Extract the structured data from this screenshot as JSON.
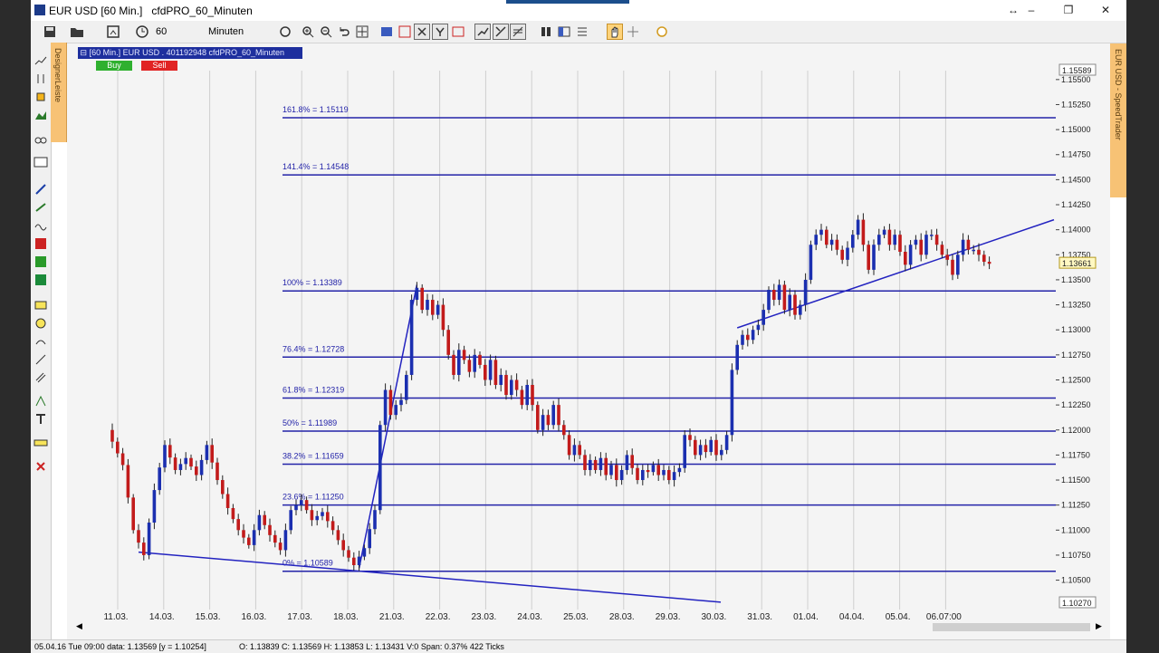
{
  "window": {
    "title": "EUR USD [60 Min.]",
    "subtitle": "cfdPRO_60_Minuten",
    "controls": [
      "↔",
      "–",
      "❐",
      "✕"
    ]
  },
  "toolbar": {
    "period_value": "60",
    "period_unit": "Minuten"
  },
  "designer_label": "DesignerLeiste",
  "speedtrader_label": "EUR USD - SpeedTrader",
  "chart_header": {
    "instrument": "[60 Min.] EUR USD . 401192948 cfdPRO_60_Minuten",
    "buy_label": "Buy",
    "sell_label": "Sell"
  },
  "chart_data": {
    "type": "candlestick",
    "instrument": "EUR USD",
    "x_tick_labels": [
      "11.03.",
      "14.03.",
      "15.03.",
      "16.03.",
      "17.03.",
      "18.03.",
      "21.03.",
      "22.03.",
      "23.03.",
      "24.03.",
      "25.03.",
      "28.03.",
      "29.03.",
      "30.03.",
      "31.03.",
      "01.04.",
      "04.04.",
      "05.04.",
      "06.07:00"
    ],
    "y_tick_labels": [
      "1.15500",
      "1.15250",
      "1.15000",
      "1.14750",
      "1.14500",
      "1.14250",
      "1.14000",
      "1.13750",
      "1.13500",
      "1.13250",
      "1.13000",
      "1.12750",
      "1.12500",
      "1.12250",
      "1.12000",
      "1.11750",
      "1.11500",
      "1.11250",
      "1.11000",
      "1.10750",
      "1.10500"
    ],
    "ylim": [
      1.1027,
      1.15589
    ],
    "axis_top_label": "1.15589",
    "axis_bottom_label": "1.10270",
    "current_price_label": "1.13661",
    "current_price": 1.13661,
    "fibonacci_levels": [
      {
        "label": "161.8% = 1.15119",
        "price": 1.15119
      },
      {
        "label": "141.4% = 1.14548",
        "price": 1.14548
      },
      {
        "label": "100% = 1.13389",
        "price": 1.13389
      },
      {
        "label": "76.4% = 1.12728",
        "price": 1.12728
      },
      {
        "label": "61.8% = 1.12319",
        "price": 1.12319
      },
      {
        "label": "50% = 1.11989",
        "price": 1.11989
      },
      {
        "label": "38.2% = 1.11659",
        "price": 1.11659
      },
      {
        "label": "23.6% = 1.11250",
        "price": 1.1125
      },
      {
        "label": "0% = 1.10589",
        "price": 1.10589
      }
    ],
    "price_path": [
      [
        0,
        1.12
      ],
      [
        3,
        1.1165
      ],
      [
        5,
        1.11
      ],
      [
        7,
        1.1075
      ],
      [
        9,
        1.114
      ],
      [
        11,
        1.1185
      ],
      [
        13,
        1.116
      ],
      [
        15,
        1.1172
      ],
      [
        17,
        1.1155
      ],
      [
        19,
        1.1185
      ],
      [
        21,
        1.115
      ],
      [
        23,
        1.1122
      ],
      [
        25,
        1.11
      ],
      [
        27,
        1.1085
      ],
      [
        29,
        1.1115
      ],
      [
        31,
        1.1095
      ],
      [
        33,
        1.108
      ],
      [
        35,
        1.112
      ],
      [
        37,
        1.113
      ],
      [
        39,
        1.111
      ],
      [
        41,
        1.1118
      ],
      [
        43,
        1.11
      ],
      [
        45,
        1.108
      ],
      [
        47,
        1.1065
      ],
      [
        49,
        1.1082
      ],
      [
        51,
        1.112
      ],
      [
        52,
        1.1205
      ],
      [
        53,
        1.124
      ],
      [
        54,
        1.1215
      ],
      [
        55,
        1.1225
      ],
      [
        56,
        1.123
      ],
      [
        57,
        1.1255
      ],
      [
        58,
        1.133
      ],
      [
        59,
        1.1342
      ],
      [
        60,
        1.132
      ],
      [
        61,
        1.133
      ],
      [
        62,
        1.1315
      ],
      [
        63,
        1.1325
      ],
      [
        64,
        1.13
      ],
      [
        65,
        1.1275
      ],
      [
        66,
        1.1255
      ],
      [
        67,
        1.128
      ],
      [
        68,
        1.127
      ],
      [
        69,
        1.1258
      ],
      [
        70,
        1.1275
      ],
      [
        71,
        1.1265
      ],
      [
        72,
        1.125
      ],
      [
        73,
        1.127
      ],
      [
        74,
        1.1245
      ],
      [
        75,
        1.1255
      ],
      [
        76,
        1.1235
      ],
      [
        77,
        1.125
      ],
      [
        78,
        1.124
      ],
      [
        79,
        1.1225
      ],
      [
        80,
        1.1245
      ],
      [
        81,
        1.1225
      ],
      [
        82,
        1.12
      ],
      [
        83,
        1.1215
      ],
      [
        84,
        1.1205
      ],
      [
        85,
        1.1225
      ],
      [
        86,
        1.1205
      ],
      [
        87,
        1.1195
      ],
      [
        88,
        1.1175
      ],
      [
        89,
        1.1185
      ],
      [
        90,
        1.1175
      ],
      [
        91,
        1.116
      ],
      [
        92,
        1.117
      ],
      [
        93,
        1.116
      ],
      [
        94,
        1.1172
      ],
      [
        95,
        1.1155
      ],
      [
        96,
        1.1165
      ],
      [
        97,
        1.115
      ],
      [
        98,
        1.116
      ],
      [
        99,
        1.1175
      ],
      [
        100,
        1.1162
      ],
      [
        101,
        1.115
      ],
      [
        102,
        1.116
      ],
      [
        103,
        1.1158
      ],
      [
        104,
        1.1165
      ],
      [
        105,
        1.1155
      ],
      [
        106,
        1.116
      ],
      [
        107,
        1.115
      ],
      [
        108,
        1.1158
      ],
      [
        109,
        1.1162
      ],
      [
        110,
        1.1195
      ],
      [
        111,
        1.119
      ],
      [
        112,
        1.1175
      ],
      [
        113,
        1.1185
      ],
      [
        114,
        1.1178
      ],
      [
        115,
        1.119
      ],
      [
        116,
        1.1175
      ],
      [
        117,
        1.118
      ],
      [
        118,
        1.1195
      ],
      [
        119,
        1.126
      ],
      [
        120,
        1.1285
      ],
      [
        121,
        1.1295
      ],
      [
        122,
        1.129
      ],
      [
        123,
        1.13
      ],
      [
        124,
        1.1305
      ],
      [
        125,
        1.132
      ],
      [
        126,
        1.134
      ],
      [
        127,
        1.133
      ],
      [
        128,
        1.1345
      ],
      [
        129,
        1.132
      ],
      [
        130,
        1.1335
      ],
      [
        131,
        1.1315
      ],
      [
        132,
        1.1325
      ],
      [
        133,
        1.135
      ],
      [
        134,
        1.1385
      ],
      [
        135,
        1.1395
      ],
      [
        136,
        1.14
      ],
      [
        137,
        1.1385
      ],
      [
        138,
        1.139
      ],
      [
        139,
        1.138
      ],
      [
        140,
        1.137
      ],
      [
        141,
        1.1382
      ],
      [
        142,
        1.1395
      ],
      [
        143,
        1.141
      ],
      [
        144,
        1.1385
      ],
      [
        145,
        1.136
      ],
      [
        146,
        1.1385
      ],
      [
        147,
        1.1395
      ],
      [
        148,
        1.14
      ],
      [
        149,
        1.1385
      ],
      [
        150,
        1.1395
      ],
      [
        151,
        1.1378
      ],
      [
        152,
        1.1365
      ],
      [
        153,
        1.1385
      ],
      [
        154,
        1.139
      ],
      [
        155,
        1.1375
      ],
      [
        156,
        1.1395
      ],
      [
        157,
        1.1395
      ],
      [
        158,
        1.1385
      ],
      [
        159,
        1.1375
      ],
      [
        160,
        1.137
      ],
      [
        161,
        1.1355
      ],
      [
        162,
        1.1375
      ],
      [
        163,
        1.139
      ],
      [
        164,
        1.138
      ],
      [
        165,
        1.138
      ],
      [
        166,
        1.1375
      ],
      [
        167,
        1.1368
      ],
      [
        168,
        1.1366
      ]
    ]
  },
  "status": {
    "left": "05.04.16 Tue  09:00 data: 1.13569 [y = 1.10254]",
    "right": "O: 1.13839 C: 1.13569 H: 1.13853 L: 1.13431 V:0 Span: 0.37% 422 Ticks"
  }
}
